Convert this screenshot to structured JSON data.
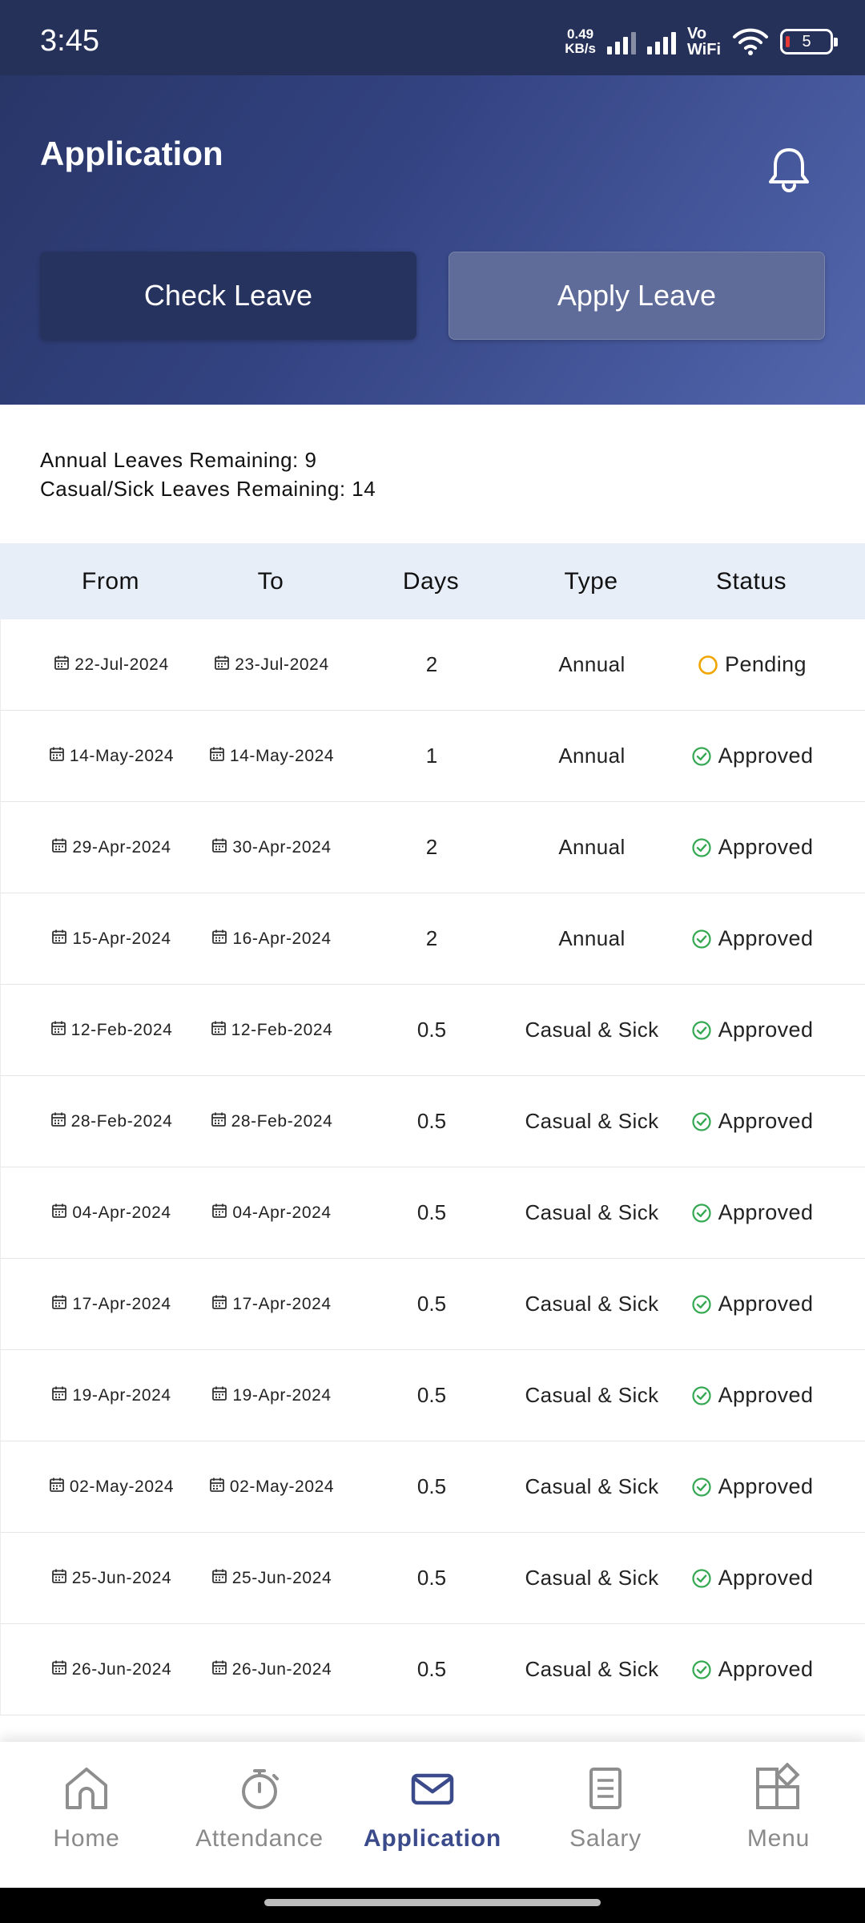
{
  "status_bar": {
    "time": "3:45",
    "net_speed_value": "0.49",
    "net_speed_unit": "KB/s",
    "vowifi_top": "Vo",
    "vowifi_bottom": "WiFi",
    "battery_level": "5"
  },
  "header": {
    "title": "Application",
    "check_leave_label": "Check Leave",
    "apply_leave_label": "Apply Leave"
  },
  "balance": {
    "annual": "Annual Leaves Remaining: 9",
    "casual_sick": "Casual/Sick Leaves Remaining: 14"
  },
  "table": {
    "columns": [
      "From",
      "To",
      "Days",
      "Type",
      "Status"
    ],
    "rows": [
      {
        "from": "22-Jul-2024",
        "to": "23-Jul-2024",
        "days": "2",
        "type": "Annual",
        "status": "Pending"
      },
      {
        "from": "14-May-2024",
        "to": "14-May-2024",
        "days": "1",
        "type": "Annual",
        "status": "Approved"
      },
      {
        "from": "29-Apr-2024",
        "to": "30-Apr-2024",
        "days": "2",
        "type": "Annual",
        "status": "Approved"
      },
      {
        "from": "15-Apr-2024",
        "to": "16-Apr-2024",
        "days": "2",
        "type": "Annual",
        "status": "Approved"
      },
      {
        "from": "12-Feb-2024",
        "to": "12-Feb-2024",
        "days": "0.5",
        "type": "Casual & Sick",
        "status": "Approved"
      },
      {
        "from": "28-Feb-2024",
        "to": "28-Feb-2024",
        "days": "0.5",
        "type": "Casual & Sick",
        "status": "Approved"
      },
      {
        "from": "04-Apr-2024",
        "to": "04-Apr-2024",
        "days": "0.5",
        "type": "Casual & Sick",
        "status": "Approved"
      },
      {
        "from": "17-Apr-2024",
        "to": "17-Apr-2024",
        "days": "0.5",
        "type": "Casual & Sick",
        "status": "Approved"
      },
      {
        "from": "19-Apr-2024",
        "to": "19-Apr-2024",
        "days": "0.5",
        "type": "Casual & Sick",
        "status": "Approved"
      },
      {
        "from": "02-May-2024",
        "to": "02-May-2024",
        "days": "0.5",
        "type": "Casual & Sick",
        "status": "Approved"
      },
      {
        "from": "25-Jun-2024",
        "to": "25-Jun-2024",
        "days": "0.5",
        "type": "Casual & Sick",
        "status": "Approved"
      },
      {
        "from": "26-Jun-2024",
        "to": "26-Jun-2024",
        "days": "0.5",
        "type": "Casual & Sick",
        "status": "Approved"
      }
    ]
  },
  "status_colors": {
    "Pending": "#f0a500",
    "Approved": "#34a853"
  },
  "bottom_nav": {
    "items": [
      {
        "label": "Home",
        "icon": "home-icon"
      },
      {
        "label": "Attendance",
        "icon": "stopwatch-icon"
      },
      {
        "label": "Application",
        "icon": "mail-icon",
        "active": true
      },
      {
        "label": "Salary",
        "icon": "document-icon"
      },
      {
        "label": "Menu",
        "icon": "grid-icon"
      }
    ]
  },
  "colors": {
    "header_start": "#273464",
    "header_end": "#5366ad",
    "nav_active": "#3a4a8a",
    "table_header_bg": "#e8eef8"
  }
}
